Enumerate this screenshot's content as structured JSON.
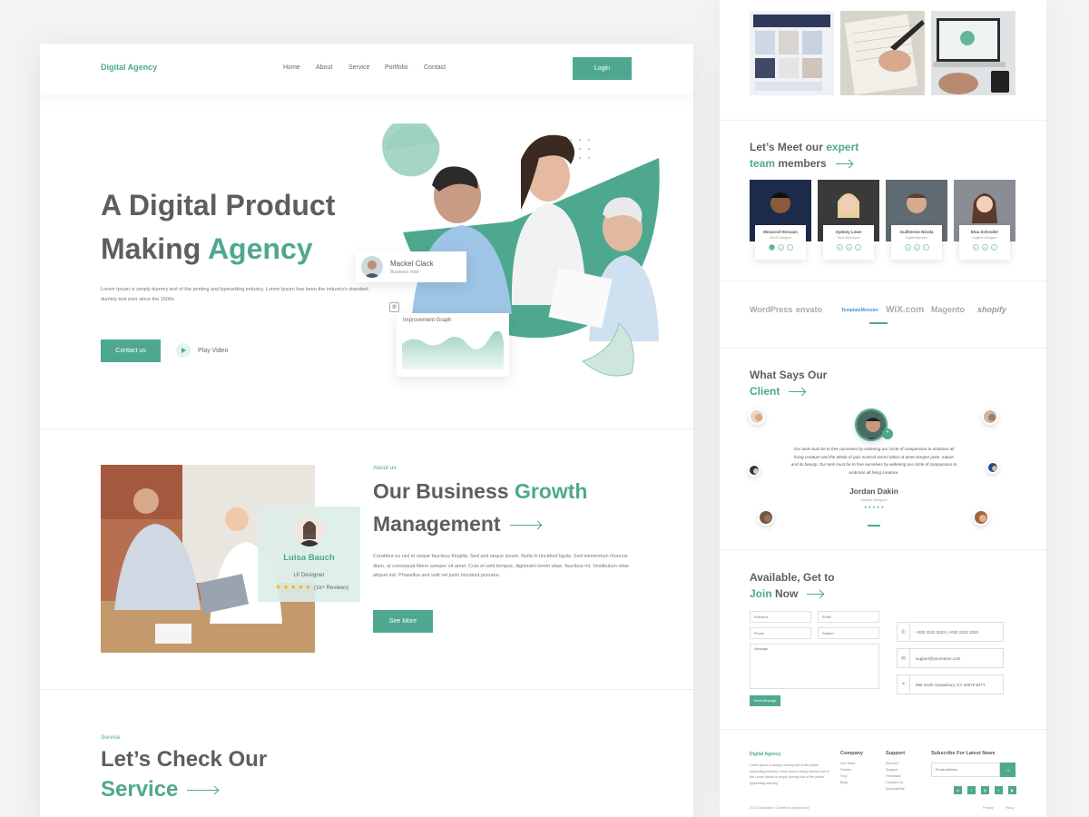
{
  "colors": {
    "accent": "#4ea88f",
    "text": "#5e5e5e"
  },
  "nav": {
    "brand": "Digital Agency",
    "links": [
      "Home",
      "About",
      "Service",
      "Portfolio",
      "Contact"
    ],
    "login": "Login"
  },
  "hero": {
    "title_line1": "A Digital Product",
    "title_line2": "Making ",
    "title_accent": "Agency",
    "desc": "Lorem Ipsum is simply dummy text of the printing and typesetting industry. Lorem Ipsum has been the industry's standard dummy text ever since the 1500s",
    "cta": "Contact us",
    "play": "Play Video",
    "badge": {
      "name": "Mackel Clack",
      "role": "Business man"
    },
    "graph_title": "Improvement Graph"
  },
  "about": {
    "tag": "About us",
    "title_line1": "Our Business ",
    "title_accent": "Growth",
    "title_line2": "Management",
    "desc": "Curabitur eu nisl et neque faucibus fringilla. Sed sed neque ipsum. Nulla in tincidunt ligula. Sed elementum rhoncus diam, ut consequat libero semper sit amet. Cras et velit tempus, dignissim lorem vitae, faucibus mi. Vestibulum vitae aliquet est. Phasellus sed velit vel justo tincidunt posuere.",
    "button": "See More",
    "person": {
      "name": "Luisa Bauch",
      "role": "UI Designer",
      "reviews": "(1k+ Reviews)",
      "stars": 5
    }
  },
  "service": {
    "tag": "Service",
    "title_line1": "Let’s Check Our",
    "title_accent": "Service"
  },
  "team": {
    "title_a": "Let’s Meet our ",
    "title_accent": "expert",
    "title_b": "team",
    "title_c": " members",
    "members": [
      {
        "name": "Mosarraf Hossain",
        "role": "UI/UX Designer"
      },
      {
        "name": "Sydney Lowe",
        "role": "Team Developer"
      },
      {
        "name": "Guilherme Nicola",
        "role": "Digital Marketer"
      },
      {
        "name": "Elsa Schroder",
        "role": "Graphic Designer"
      }
    ]
  },
  "brands": [
    "WordPress",
    "envato",
    "TemplateMonster",
    "WiX.com",
    "Magento",
    "shopify"
  ],
  "testimonial": {
    "title_a": "What Says Our",
    "title_accent": "Client",
    "quote": "Our task must be to free ourselves by widening our circle of compassion to embrace all living creature and the whole of quis nostrud exerci tation ut amet semper justo. nature and its beauty. Our task must be to free ourselves by widening our circle of compassion to embrace all living creature.",
    "name": "Jordan Dakin",
    "role": "Graphic Designer"
  },
  "contact": {
    "title_a": "Available, Get to",
    "title_accent": "Join",
    "title_b": " Now",
    "fields": {
      "fullname": "Fullname",
      "email": "Email",
      "phone": "Phone",
      "subject": "Subject",
      "message": "Message"
    },
    "send": "Send Message",
    "phone": "+000 2222 3333   |   +000 2222 3333",
    "email_info": "support@yourname.com",
    "address": "895 North Opaasbury, NY 23579-5477"
  },
  "footer": {
    "brand": "Digital Agency",
    "about": "Lorem Ipsum is simply dummy text of the printin typesetting industry Lorem Ipsum simply dummy text of the Lorem Ipsum is simply dummy text of the printin typesetting industry.",
    "company": {
      "title": "Company",
      "links": [
        "Our Team",
        "Partner",
        "FAQ",
        "Blog"
      ]
    },
    "support": {
      "title": "Support",
      "links": [
        "Account",
        "Support",
        "Feedback",
        "Contact Us",
        "Accessibility"
      ]
    },
    "subscribe": {
      "title": "Subscribe For Latest News",
      "placeholder": "Email address"
    },
    "copyright": "2021 ©Abdulkim. Created by graphicsoul",
    "legal": [
      "Privacy",
      "Policy"
    ]
  }
}
